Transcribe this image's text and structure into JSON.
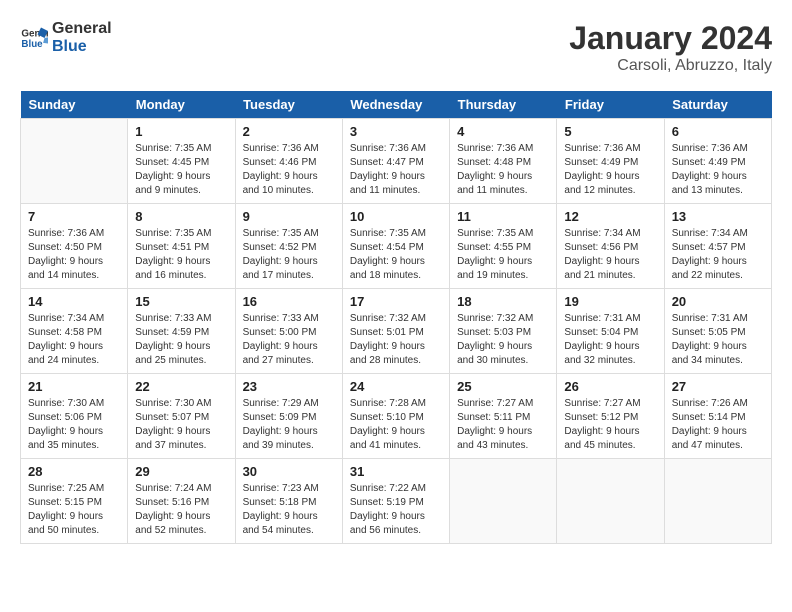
{
  "header": {
    "logo_line1": "General",
    "logo_line2": "Blue",
    "month": "January 2024",
    "location": "Carsoli, Abruzzo, Italy"
  },
  "days_of_week": [
    "Sunday",
    "Monday",
    "Tuesday",
    "Wednesday",
    "Thursday",
    "Friday",
    "Saturday"
  ],
  "weeks": [
    [
      {
        "day": "",
        "info": ""
      },
      {
        "day": "1",
        "info": "Sunrise: 7:35 AM\nSunset: 4:45 PM\nDaylight: 9 hours\nand 9 minutes."
      },
      {
        "day": "2",
        "info": "Sunrise: 7:36 AM\nSunset: 4:46 PM\nDaylight: 9 hours\nand 10 minutes."
      },
      {
        "day": "3",
        "info": "Sunrise: 7:36 AM\nSunset: 4:47 PM\nDaylight: 9 hours\nand 11 minutes."
      },
      {
        "day": "4",
        "info": "Sunrise: 7:36 AM\nSunset: 4:48 PM\nDaylight: 9 hours\nand 11 minutes."
      },
      {
        "day": "5",
        "info": "Sunrise: 7:36 AM\nSunset: 4:49 PM\nDaylight: 9 hours\nand 12 minutes."
      },
      {
        "day": "6",
        "info": "Sunrise: 7:36 AM\nSunset: 4:49 PM\nDaylight: 9 hours\nand 13 minutes."
      }
    ],
    [
      {
        "day": "7",
        "info": "Sunrise: 7:36 AM\nSunset: 4:50 PM\nDaylight: 9 hours\nand 14 minutes."
      },
      {
        "day": "8",
        "info": "Sunrise: 7:35 AM\nSunset: 4:51 PM\nDaylight: 9 hours\nand 16 minutes."
      },
      {
        "day": "9",
        "info": "Sunrise: 7:35 AM\nSunset: 4:52 PM\nDaylight: 9 hours\nand 17 minutes."
      },
      {
        "day": "10",
        "info": "Sunrise: 7:35 AM\nSunset: 4:54 PM\nDaylight: 9 hours\nand 18 minutes."
      },
      {
        "day": "11",
        "info": "Sunrise: 7:35 AM\nSunset: 4:55 PM\nDaylight: 9 hours\nand 19 minutes."
      },
      {
        "day": "12",
        "info": "Sunrise: 7:34 AM\nSunset: 4:56 PM\nDaylight: 9 hours\nand 21 minutes."
      },
      {
        "day": "13",
        "info": "Sunrise: 7:34 AM\nSunset: 4:57 PM\nDaylight: 9 hours\nand 22 minutes."
      }
    ],
    [
      {
        "day": "14",
        "info": "Sunrise: 7:34 AM\nSunset: 4:58 PM\nDaylight: 9 hours\nand 24 minutes."
      },
      {
        "day": "15",
        "info": "Sunrise: 7:33 AM\nSunset: 4:59 PM\nDaylight: 9 hours\nand 25 minutes."
      },
      {
        "day": "16",
        "info": "Sunrise: 7:33 AM\nSunset: 5:00 PM\nDaylight: 9 hours\nand 27 minutes."
      },
      {
        "day": "17",
        "info": "Sunrise: 7:32 AM\nSunset: 5:01 PM\nDaylight: 9 hours\nand 28 minutes."
      },
      {
        "day": "18",
        "info": "Sunrise: 7:32 AM\nSunset: 5:03 PM\nDaylight: 9 hours\nand 30 minutes."
      },
      {
        "day": "19",
        "info": "Sunrise: 7:31 AM\nSunset: 5:04 PM\nDaylight: 9 hours\nand 32 minutes."
      },
      {
        "day": "20",
        "info": "Sunrise: 7:31 AM\nSunset: 5:05 PM\nDaylight: 9 hours\nand 34 minutes."
      }
    ],
    [
      {
        "day": "21",
        "info": "Sunrise: 7:30 AM\nSunset: 5:06 PM\nDaylight: 9 hours\nand 35 minutes."
      },
      {
        "day": "22",
        "info": "Sunrise: 7:30 AM\nSunset: 5:07 PM\nDaylight: 9 hours\nand 37 minutes."
      },
      {
        "day": "23",
        "info": "Sunrise: 7:29 AM\nSunset: 5:09 PM\nDaylight: 9 hours\nand 39 minutes."
      },
      {
        "day": "24",
        "info": "Sunrise: 7:28 AM\nSunset: 5:10 PM\nDaylight: 9 hours\nand 41 minutes."
      },
      {
        "day": "25",
        "info": "Sunrise: 7:27 AM\nSunset: 5:11 PM\nDaylight: 9 hours\nand 43 minutes."
      },
      {
        "day": "26",
        "info": "Sunrise: 7:27 AM\nSunset: 5:12 PM\nDaylight: 9 hours\nand 45 minutes."
      },
      {
        "day": "27",
        "info": "Sunrise: 7:26 AM\nSunset: 5:14 PM\nDaylight: 9 hours\nand 47 minutes."
      }
    ],
    [
      {
        "day": "28",
        "info": "Sunrise: 7:25 AM\nSunset: 5:15 PM\nDaylight: 9 hours\nand 50 minutes."
      },
      {
        "day": "29",
        "info": "Sunrise: 7:24 AM\nSunset: 5:16 PM\nDaylight: 9 hours\nand 52 minutes."
      },
      {
        "day": "30",
        "info": "Sunrise: 7:23 AM\nSunset: 5:18 PM\nDaylight: 9 hours\nand 54 minutes."
      },
      {
        "day": "31",
        "info": "Sunrise: 7:22 AM\nSunset: 5:19 PM\nDaylight: 9 hours\nand 56 minutes."
      },
      {
        "day": "",
        "info": ""
      },
      {
        "day": "",
        "info": ""
      },
      {
        "day": "",
        "info": ""
      }
    ]
  ]
}
